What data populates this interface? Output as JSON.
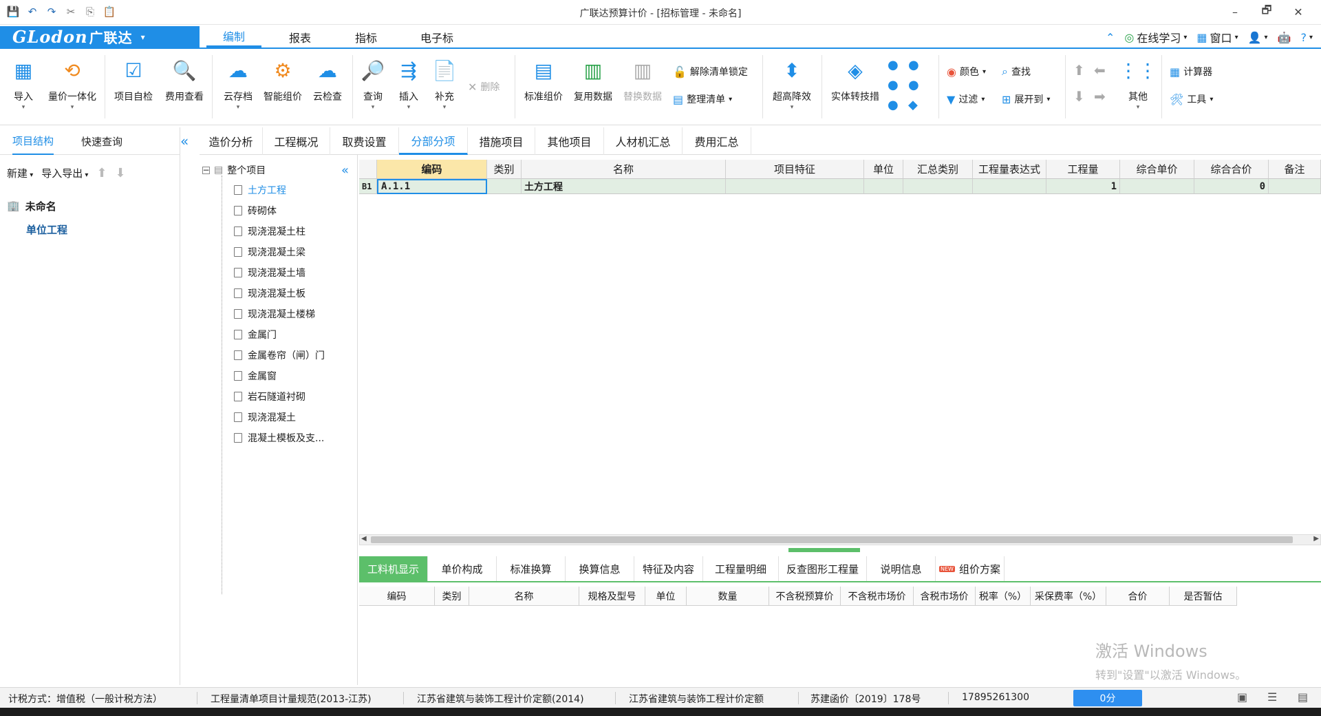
{
  "window": {
    "title": "广联达预算计价 - [招标管理 - 未命名]",
    "min": "–",
    "max": "🗗",
    "close": "✕"
  },
  "quick_access": [
    "save-icon",
    "undo-icon",
    "redo-icon",
    "cut-icon",
    "copy-icon",
    "paste-icon"
  ],
  "logo": {
    "latin": "GLodon",
    "cn": "广联达",
    "caret": "▾"
  },
  "menu_tabs": [
    "编制",
    "报表",
    "指标",
    "电子标"
  ],
  "menu_right": {
    "learn": "在线学习",
    "window": "窗口",
    "help": "?"
  },
  "ribbon": {
    "import": "导入",
    "qty_price": "量价一体化",
    "self_check": "项目自检",
    "fee_view": "费用查看",
    "cloud_save": "云存档",
    "smart_price": "智能组价",
    "cloud_check": "云检查",
    "query": "查询",
    "insert": "插入",
    "supplement": "补充",
    "delete": "删除",
    "std_price": "标准组价",
    "reuse_data": "复用数据",
    "replace_data": "替换数据",
    "unlock_list": "解除清单锁定",
    "organize_list": "整理清单",
    "super_high": "超高降效",
    "entity_measure": "实体转技措",
    "color": "颜色",
    "find": "查找",
    "filter": "过滤",
    "expand_to": "展开到",
    "other": "其他",
    "calculator": "计算器",
    "tools": "工具"
  },
  "left_panel": {
    "tabs": [
      "项目结构",
      "快速查询"
    ],
    "new": "新建",
    "import_export": "导入导出",
    "project": "未命名",
    "unit": "单位工程"
  },
  "main_tabs": [
    "造价分析",
    "工程概况",
    "取费设置",
    "分部分项",
    "措施项目",
    "其他项目",
    "人材机汇总",
    "费用汇总"
  ],
  "tree": {
    "root": "整个项目",
    "items": [
      "土方工程",
      "砖砌体",
      "现浇混凝土柱",
      "现浇混凝土梁",
      "现浇混凝土墙",
      "现浇混凝土板",
      "现浇混凝土楼梯",
      "金属门",
      "金属卷帘（闸）门",
      "金属窗",
      "岩石隧道衬砌",
      "现浇混凝土",
      "混凝土模板及支..."
    ]
  },
  "grid": {
    "headers": [
      "编码",
      "类别",
      "名称",
      "项目特征",
      "单位",
      "汇总类别",
      "工程量表达式",
      "工程量",
      "综合单价",
      "综合合价",
      "备注"
    ],
    "row": {
      "tag": "B1",
      "code": "A.1.1",
      "category": "",
      "name": "土方工程",
      "feature": "",
      "unit": "",
      "sum_cat": "",
      "expr": "",
      "qty": "1",
      "unit_price": "",
      "total": "0",
      "note": ""
    }
  },
  "bottom_tabs": [
    "工料机显示",
    "单价构成",
    "标准换算",
    "换算信息",
    "特征及内容",
    "工程量明细",
    "反查图形工程量",
    "说明信息",
    "组价方案"
  ],
  "bottom_headers": [
    "编码",
    "类别",
    "名称",
    "规格及型号",
    "单位",
    "数量",
    "不含税预算价",
    "不含税市场价",
    "含税市场价",
    "税率（%）",
    "采保费率（%）",
    "合价",
    "是否暂估"
  ],
  "watermark": {
    "line1": "激活 Windows",
    "line2": "转到\"设置\"以激活 Windows。"
  },
  "status": {
    "tax": "计税方式：增值税（一般计税方法）",
    "spec": "工程量清单项目计量规范(2013-江苏)",
    "quota1": "江苏省建筑与装饰工程计价定额(2014)",
    "quota2": "江苏省建筑与装饰工程计价定额",
    "doc": "苏建函价〔2019〕178号",
    "phone": "17895261300",
    "score": "0分"
  },
  "colors": {
    "accent": "#1f8ee6",
    "green": "#5cbf6a",
    "row": "#e2eee3",
    "selected_header": "#fbe7a9"
  }
}
